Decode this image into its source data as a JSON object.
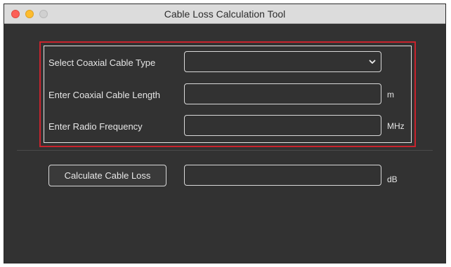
{
  "window": {
    "title": "Cable Loss Calculation Tool"
  },
  "form": {
    "cable_type_label": "Select Coaxial Cable Type",
    "cable_type_value": "",
    "length_label": "Enter Coaxial Cable Length",
    "length_value": "",
    "length_unit": "m",
    "frequency_label": "Enter Radio Frequency",
    "frequency_value": "",
    "frequency_unit": "MHz"
  },
  "calculate": {
    "button_label": "Calculate Cable Loss",
    "result_value": "",
    "result_unit": "dB"
  },
  "icons": {
    "dropdown": "chevron-down-icon"
  },
  "colors": {
    "highlight_border": "#c9232d",
    "window_background": "#323232",
    "traffic_close": "#fc5f57",
    "traffic_minimize": "#fdbc2e",
    "traffic_zoom_inactive": "#d0d0d0"
  }
}
